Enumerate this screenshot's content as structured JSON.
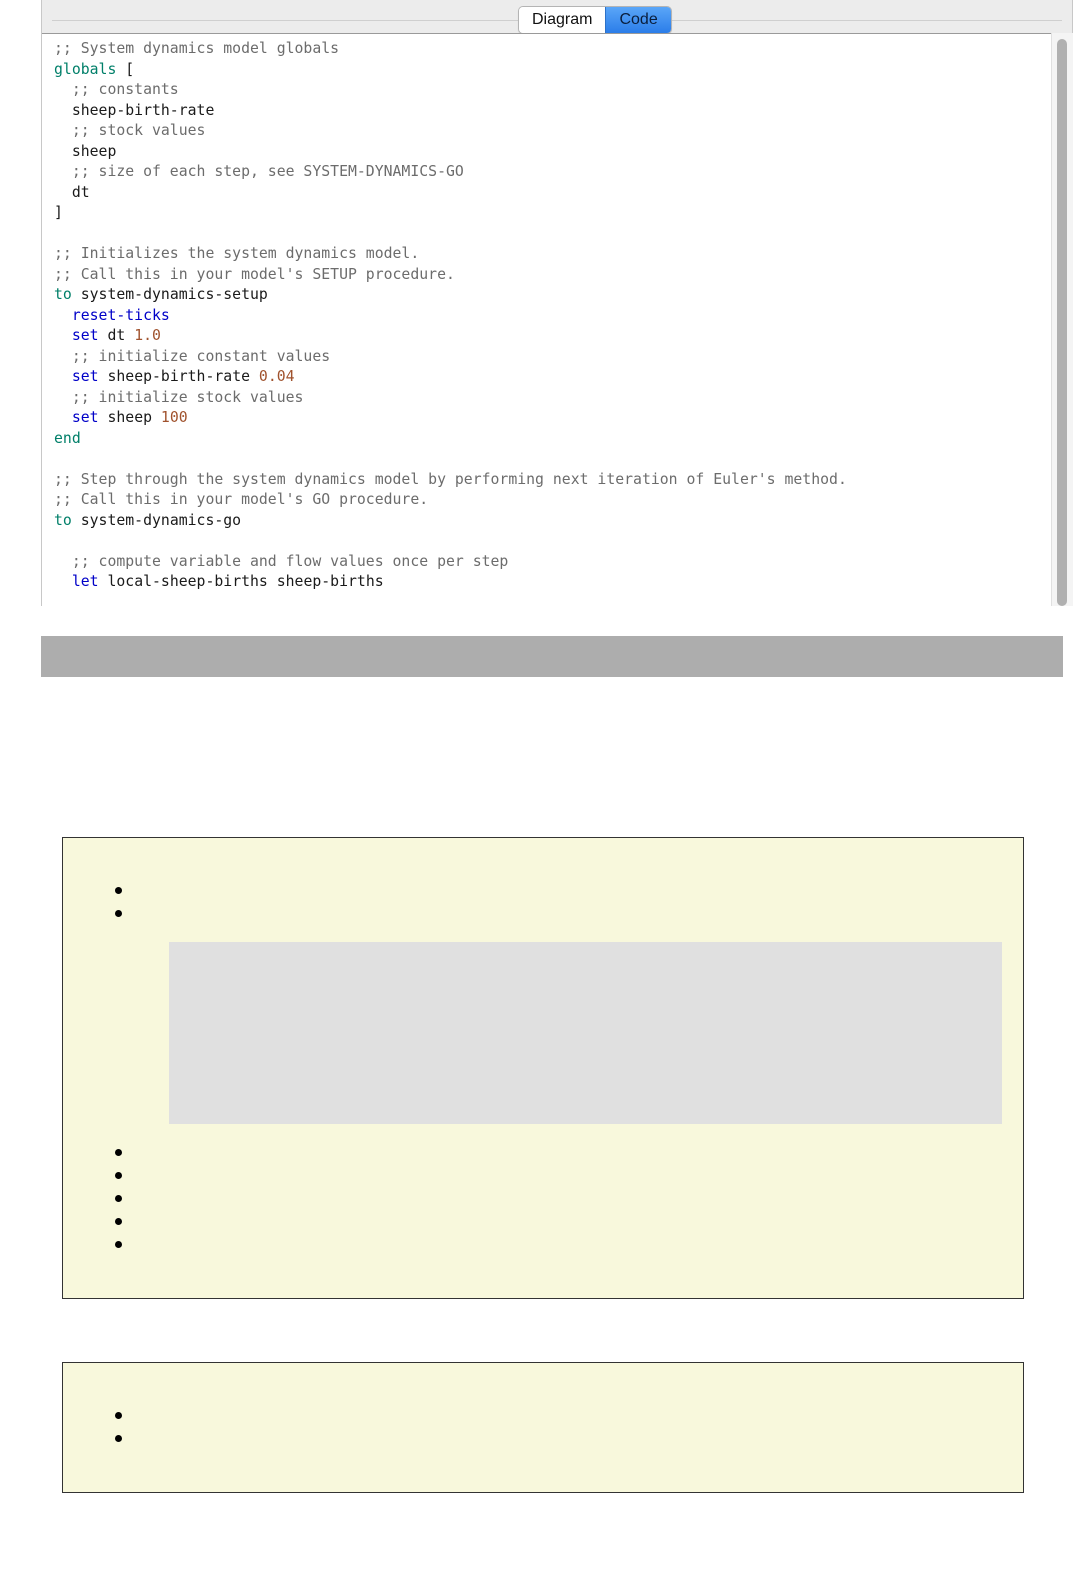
{
  "editor": {
    "tabs": [
      {
        "label": "Diagram",
        "active": false
      },
      {
        "label": "Code",
        "active": true
      }
    ],
    "code_lines": [
      [
        {
          "t": ";; System dynamics model globals",
          "c": "comment"
        }
      ],
      [
        {
          "t": "globals",
          "c": "keyword"
        },
        {
          "t": " [",
          "c": "plain"
        }
      ],
      [
        {
          "t": "  ;; constants",
          "c": "comment"
        }
      ],
      [
        {
          "t": "  sheep-birth-rate",
          "c": "plain"
        }
      ],
      [
        {
          "t": "  ;; stock values",
          "c": "comment"
        }
      ],
      [
        {
          "t": "  sheep",
          "c": "plain"
        }
      ],
      [
        {
          "t": "  ;; size of each step, see SYSTEM-DYNAMICS-GO",
          "c": "comment"
        }
      ],
      [
        {
          "t": "  dt",
          "c": "plain"
        }
      ],
      [
        {
          "t": "]",
          "c": "plain"
        }
      ],
      [],
      [
        {
          "t": ";; Initializes the system dynamics model.",
          "c": "comment"
        }
      ],
      [
        {
          "t": ";; Call this in your model's SETUP procedure.",
          "c": "comment"
        }
      ],
      [
        {
          "t": "to",
          "c": "keyword"
        },
        {
          "t": " system-dynamics-setup",
          "c": "plain"
        }
      ],
      [
        {
          "t": "  ",
          "c": "plain"
        },
        {
          "t": "reset-ticks",
          "c": "command"
        }
      ],
      [
        {
          "t": "  ",
          "c": "plain"
        },
        {
          "t": "set",
          "c": "command"
        },
        {
          "t": " dt ",
          "c": "plain"
        },
        {
          "t": "1.0",
          "c": "number"
        }
      ],
      [
        {
          "t": "  ;; initialize constant values",
          "c": "comment"
        }
      ],
      [
        {
          "t": "  ",
          "c": "plain"
        },
        {
          "t": "set",
          "c": "command"
        },
        {
          "t": " sheep-birth-rate ",
          "c": "plain"
        },
        {
          "t": "0.04",
          "c": "number"
        }
      ],
      [
        {
          "t": "  ;; initialize stock values",
          "c": "comment"
        }
      ],
      [
        {
          "t": "  ",
          "c": "plain"
        },
        {
          "t": "set",
          "c": "command"
        },
        {
          "t": " sheep ",
          "c": "plain"
        },
        {
          "t": "100",
          "c": "number"
        }
      ],
      [
        {
          "t": "end",
          "c": "keyword"
        }
      ],
      [],
      [
        {
          "t": ";; Step through the system dynamics model by performing next iteration of Euler's method.",
          "c": "comment"
        }
      ],
      [
        {
          "t": ";; Call this in your model's GO procedure.",
          "c": "comment"
        }
      ],
      [
        {
          "t": "to",
          "c": "keyword"
        },
        {
          "t": " system-dynamics-go",
          "c": "plain"
        }
      ],
      [],
      [
        {
          "t": "  ;; compute variable and flow values once per step",
          "c": "comment"
        }
      ],
      [
        {
          "t": "  ",
          "c": "plain"
        },
        {
          "t": "let",
          "c": "command"
        },
        {
          "t": " local-sheep-births sheep-births",
          "c": "plain"
        }
      ]
    ]
  },
  "colors": {
    "comment": "#6c6c6c",
    "keyword": "#007f69",
    "command": "#0000c8",
    "number": "#a0522d",
    "note_background": "#f8f8dc",
    "tab_active": "#2b7de9"
  },
  "note_box_1": {
    "bullet_count": 7
  },
  "note_box_2": {
    "bullet_count": 2
  }
}
